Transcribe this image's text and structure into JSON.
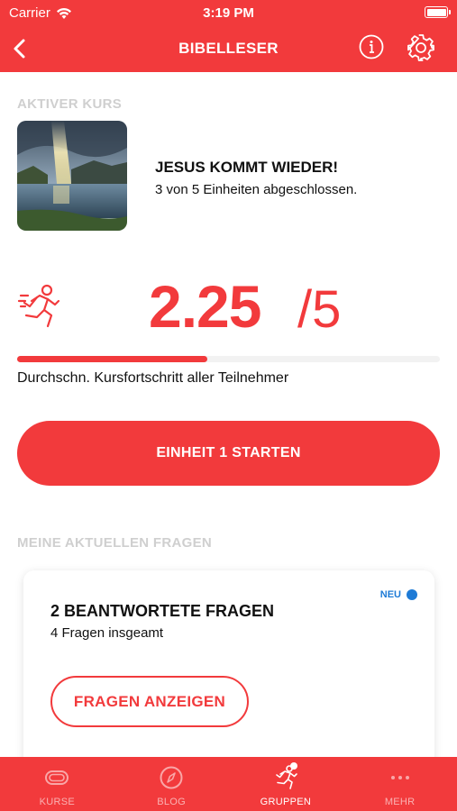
{
  "status_bar": {
    "carrier": "Carrier",
    "time": "3:19 PM"
  },
  "nav": {
    "title": "BIBELLESER",
    "back_icon": "chevron-left-icon",
    "info_icon": "info-icon",
    "settings_icon": "gear-icon"
  },
  "active_course": {
    "section_label": "AKTIVER KURS",
    "title": "JESUS KOMMT WIEDER!",
    "subtitle": "3 von 5 Einheiten abgeschlossen.",
    "image": "lake-landscape-sunrays"
  },
  "progress": {
    "score": "2.25",
    "max": "/5",
    "fraction": 0.45,
    "label": "Durchschn. Kursfortschritt aller Teilnehmer"
  },
  "start_button": {
    "label": "EINHEIT 1 STARTEN"
  },
  "questions": {
    "section_label": "MEINE AKTUELLEN FRAGEN",
    "badge": "NEU",
    "title": "2 BEANTWORTETE FRAGEN",
    "subtitle": "4 Fragen insgeamt",
    "button_label": "FRAGEN ANZEIGEN"
  },
  "tabs": [
    {
      "label": "KURSE",
      "icon": "track-icon",
      "active": false
    },
    {
      "label": "BLOG",
      "icon": "compass-icon",
      "active": false
    },
    {
      "label": "GRUPPEN",
      "icon": "runner-icon",
      "active": true,
      "dot": true
    },
    {
      "label": "MEHR",
      "icon": "more-dots-icon",
      "active": false
    }
  ],
  "colors": {
    "accent": "#f23a3c",
    "badge": "#1e7bd6",
    "section_label": "#cfcfcf"
  }
}
